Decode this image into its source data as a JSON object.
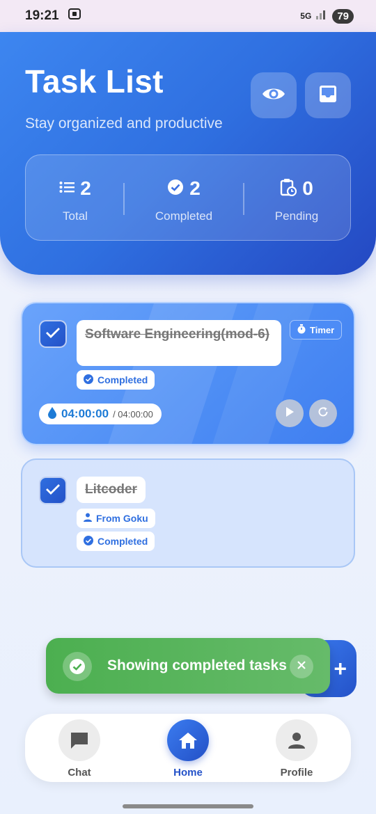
{
  "status_bar": {
    "time": "19:21",
    "network": "5G",
    "battery": "79"
  },
  "header": {
    "title": "Task List",
    "subtitle": "Stay organized and productive",
    "stats": [
      {
        "value": "2",
        "label": "Total",
        "icon": "list-icon"
      },
      {
        "value": "2",
        "label": "Completed",
        "icon": "check-circle-icon"
      },
      {
        "value": "0",
        "label": "Pending",
        "icon": "clipboard-clock-icon"
      }
    ]
  },
  "tasks": [
    {
      "title": "Software Engineering(mod-6)",
      "status_label": "Completed",
      "timer_label": "Timer",
      "elapsed": "04:00:00",
      "total": "/ 04:00:00",
      "completed": true
    },
    {
      "title": "Litcoder",
      "from_label": "From Goku",
      "status_label": "Completed",
      "completed": true
    }
  ],
  "snackbar": {
    "message": "Showing completed tasks"
  },
  "fab": {
    "label": "+"
  },
  "nav": {
    "items": [
      {
        "label": "Chat",
        "icon": "chat-icon"
      },
      {
        "label": "Home",
        "icon": "home-icon",
        "active": true
      },
      {
        "label": "Profile",
        "icon": "person-icon"
      }
    ]
  },
  "colors": {
    "primary": "#2f6fe0",
    "success": "#4caf50",
    "card_blue": "#4f8ff5"
  }
}
